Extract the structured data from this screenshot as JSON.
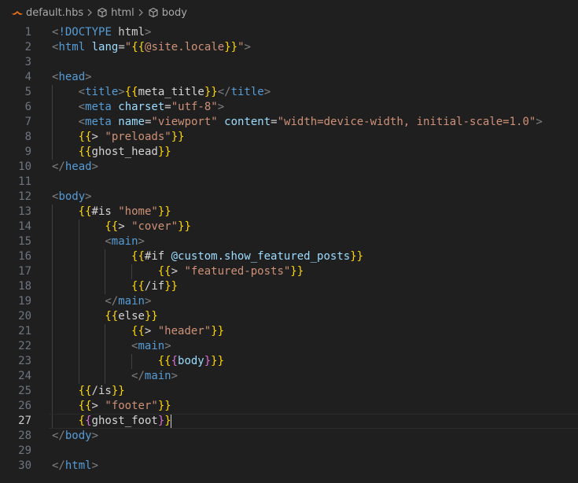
{
  "breadcrumb": {
    "file": "default.hbs",
    "items": [
      "html",
      "body"
    ]
  },
  "colors": {
    "background": "#1f1f1f",
    "tag": "#569cd6",
    "attribute": "#9cdcfe",
    "string": "#ce9178",
    "brace_outer": "#ffd700",
    "brace_inner": "#da70d6",
    "brace_third": "#179fff"
  },
  "editor": {
    "current_line": 27,
    "lines": [
      {
        "n": "1",
        "indent": 0,
        "tokens": [
          [
            "pun",
            "<"
          ],
          [
            "tag",
            "!DOCTYPE"
          ],
          [
            "txt",
            " html"
          ],
          [
            "pun",
            ">"
          ]
        ]
      },
      {
        "n": "2",
        "indent": 0,
        "tokens": [
          [
            "pun",
            "<"
          ],
          [
            "tag",
            "html"
          ],
          [
            "txt",
            " "
          ],
          [
            "attr",
            "lang"
          ],
          [
            "txt",
            "="
          ],
          [
            "str",
            "\""
          ],
          [
            "br1",
            "{{"
          ],
          [
            "str",
            "@site.locale"
          ],
          [
            "br1",
            "}}"
          ],
          [
            "str",
            "\""
          ],
          [
            "pun",
            ">"
          ]
        ]
      },
      {
        "n": "3",
        "indent": 0,
        "tokens": []
      },
      {
        "n": "4",
        "indent": 0,
        "tokens": [
          [
            "pun",
            "<"
          ],
          [
            "tag",
            "head"
          ],
          [
            "pun",
            ">"
          ]
        ]
      },
      {
        "n": "5",
        "indent": 1,
        "tokens": [
          [
            "pun",
            "<"
          ],
          [
            "tag",
            "title"
          ],
          [
            "pun",
            ">"
          ],
          [
            "br1",
            "{{"
          ],
          [
            "tpl",
            "meta_title"
          ],
          [
            "br1",
            "}}"
          ],
          [
            "pun",
            "</"
          ],
          [
            "tag",
            "title"
          ],
          [
            "pun",
            ">"
          ]
        ]
      },
      {
        "n": "6",
        "indent": 1,
        "tokens": [
          [
            "pun",
            "<"
          ],
          [
            "tag",
            "meta"
          ],
          [
            "txt",
            " "
          ],
          [
            "attr",
            "charset"
          ],
          [
            "txt",
            "="
          ],
          [
            "str",
            "\"utf-8\""
          ],
          [
            "pun",
            ">"
          ]
        ]
      },
      {
        "n": "7",
        "indent": 1,
        "tokens": [
          [
            "pun",
            "<"
          ],
          [
            "tag",
            "meta"
          ],
          [
            "txt",
            " "
          ],
          [
            "attr",
            "name"
          ],
          [
            "txt",
            "="
          ],
          [
            "str",
            "\"viewport\""
          ],
          [
            "txt",
            " "
          ],
          [
            "attr",
            "content"
          ],
          [
            "txt",
            "="
          ],
          [
            "str",
            "\"width=device-width, initial-scale=1.0\""
          ],
          [
            "pun",
            ">"
          ]
        ]
      },
      {
        "n": "8",
        "indent": 1,
        "tokens": [
          [
            "br1",
            "{{"
          ],
          [
            "tpl",
            "> "
          ],
          [
            "str",
            "\"preloads\""
          ],
          [
            "br1",
            "}}"
          ]
        ]
      },
      {
        "n": "9",
        "indent": 1,
        "tokens": [
          [
            "br1",
            "{{"
          ],
          [
            "tpl",
            "ghost_head"
          ],
          [
            "br1",
            "}}"
          ]
        ]
      },
      {
        "n": "10",
        "indent": 0,
        "tokens": [
          [
            "pun",
            "</"
          ],
          [
            "tag",
            "head"
          ],
          [
            "pun",
            ">"
          ]
        ]
      },
      {
        "n": "11",
        "indent": 0,
        "tokens": []
      },
      {
        "n": "12",
        "indent": 0,
        "tokens": [
          [
            "pun",
            "<"
          ],
          [
            "tag",
            "body"
          ],
          [
            "pun",
            ">"
          ]
        ]
      },
      {
        "n": "13",
        "indent": 1,
        "tokens": [
          [
            "br1",
            "{{"
          ],
          [
            "tpl",
            "#is "
          ],
          [
            "str",
            "\"home\""
          ],
          [
            "br1",
            "}}"
          ]
        ]
      },
      {
        "n": "14",
        "indent": 2,
        "tokens": [
          [
            "br1",
            "{{"
          ],
          [
            "tpl",
            "> "
          ],
          [
            "str",
            "\"cover\""
          ],
          [
            "br1",
            "}}"
          ]
        ]
      },
      {
        "n": "15",
        "indent": 2,
        "tokens": [
          [
            "pun",
            "<"
          ],
          [
            "tag",
            "main"
          ],
          [
            "pun",
            ">"
          ]
        ]
      },
      {
        "n": "16",
        "indent": 3,
        "tokens": [
          [
            "br1",
            "{{"
          ],
          [
            "tpl",
            "#if "
          ],
          [
            "var",
            "@custom.show_featured_posts"
          ],
          [
            "br1",
            "}}"
          ]
        ]
      },
      {
        "n": "17",
        "indent": 4,
        "tokens": [
          [
            "br1",
            "{{"
          ],
          [
            "tpl",
            "> "
          ],
          [
            "str",
            "\"featured-posts\""
          ],
          [
            "br1",
            "}}"
          ]
        ]
      },
      {
        "n": "18",
        "indent": 3,
        "tokens": [
          [
            "br1",
            "{{"
          ],
          [
            "tpl",
            "/if"
          ],
          [
            "br1",
            "}}"
          ]
        ]
      },
      {
        "n": "19",
        "indent": 2,
        "tokens": [
          [
            "pun",
            "</"
          ],
          [
            "tag",
            "main"
          ],
          [
            "pun",
            ">"
          ]
        ]
      },
      {
        "n": "20",
        "indent": 2,
        "tokens": [
          [
            "br1",
            "{{"
          ],
          [
            "tpl",
            "else"
          ],
          [
            "br1",
            "}}"
          ]
        ]
      },
      {
        "n": "21",
        "indent": 3,
        "tokens": [
          [
            "br1",
            "{{"
          ],
          [
            "tpl",
            "> "
          ],
          [
            "str",
            "\"header\""
          ],
          [
            "br1",
            "}}"
          ]
        ]
      },
      {
        "n": "22",
        "indent": 3,
        "tokens": [
          [
            "pun",
            "<"
          ],
          [
            "tag",
            "main"
          ],
          [
            "pun",
            ">"
          ]
        ]
      },
      {
        "n": "23",
        "indent": 4,
        "tokens": [
          [
            "br1",
            "{{"
          ],
          [
            "br2",
            "{"
          ],
          [
            "var",
            "body"
          ],
          [
            "br2",
            "}"
          ],
          [
            "br1",
            "}}"
          ]
        ]
      },
      {
        "n": "24",
        "indent": 3,
        "tokens": [
          [
            "pun",
            "</"
          ],
          [
            "tag",
            "main"
          ],
          [
            "pun",
            ">"
          ]
        ]
      },
      {
        "n": "25",
        "indent": 1,
        "tokens": [
          [
            "br1",
            "{{"
          ],
          [
            "tpl",
            "/is"
          ],
          [
            "br1",
            "}}"
          ]
        ]
      },
      {
        "n": "26",
        "indent": 1,
        "tokens": [
          [
            "br1",
            "{{"
          ],
          [
            "tpl",
            "> "
          ],
          [
            "str",
            "\"footer\""
          ],
          [
            "br1",
            "}}"
          ]
        ]
      },
      {
        "n": "27",
        "indent": 1,
        "tokens": [
          [
            "br1",
            "{"
          ],
          [
            "br2",
            "{"
          ],
          [
            "tpl",
            "ghost_foot"
          ],
          [
            "br2",
            "}"
          ],
          [
            "br1",
            "}"
          ]
        ]
      },
      {
        "n": "28",
        "indent": 0,
        "tokens": [
          [
            "pun",
            "</"
          ],
          [
            "tag",
            "body"
          ],
          [
            "pun",
            ">"
          ]
        ]
      },
      {
        "n": "29",
        "indent": 0,
        "tokens": []
      },
      {
        "n": "30",
        "indent": 0,
        "tokens": [
          [
            "pun",
            "</"
          ],
          [
            "tag",
            "html"
          ],
          [
            "pun",
            ">"
          ]
        ]
      }
    ]
  }
}
